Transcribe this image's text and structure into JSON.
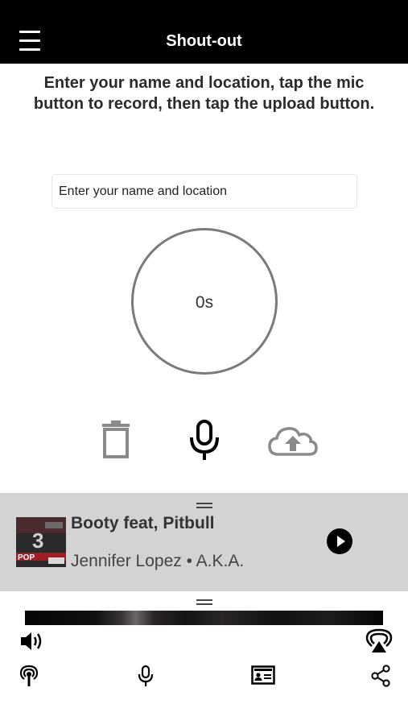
{
  "header": {
    "title": "Shout-out",
    "menu_icon": "hamburger-menu-icon"
  },
  "instructions": "Enter your name and location, tap the mic button to record, then tap the upload button.",
  "name_field": {
    "placeholder": "Enter your name and location",
    "value": ""
  },
  "recorder": {
    "elapsed": "0s"
  },
  "controls": {
    "delete_icon": "trash-icon",
    "record_icon": "microphone-icon",
    "upload_icon": "cloud-upload-icon"
  },
  "now_playing": {
    "title": "Booty feat, Pitbull",
    "artist": "Jennifer Lopez",
    "separator": "•",
    "album": "A.K.A.",
    "artwork_text_number": "3",
    "artwork_text_label": "POP",
    "play_icon": "play-icon"
  },
  "bottom_bar": {
    "row1": [
      "speaker-volume-icon",
      "airplay-icon"
    ],
    "row2": [
      "podcast-broadcast-icon",
      "microphone-icon",
      "contact-card-icon",
      "share-icon"
    ]
  },
  "colors": {
    "header_bg": "#000000",
    "player_bg": "#d3d3d3",
    "circle_stroke": "#7a7a7a",
    "control_gray": "#8a8a8a"
  }
}
